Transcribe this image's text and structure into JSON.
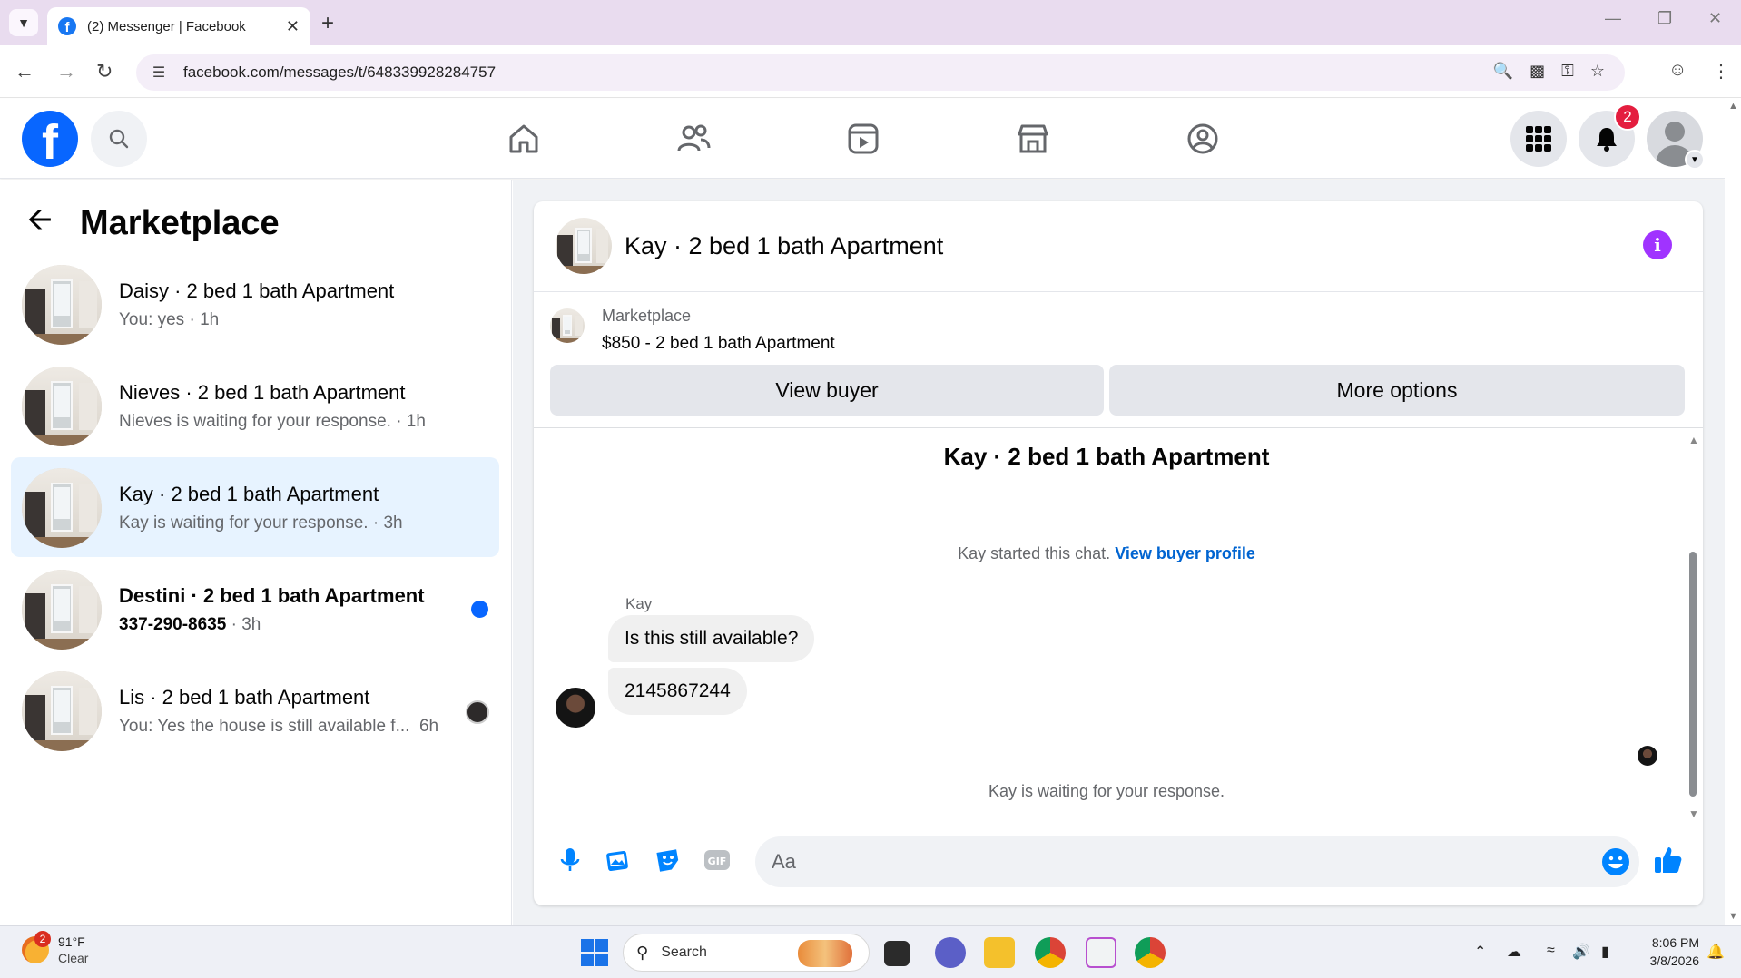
{
  "browser": {
    "tab_title": "(2) Messenger | Facebook",
    "url": "facebook.com/messages/t/648339928284757"
  },
  "header": {
    "notifications_count": "2"
  },
  "sidebar": {
    "title": "Marketplace",
    "conversations": [
      {
        "name": "Daisy · 2 bed 1 bath Apartment",
        "preview": "You: yes · 1h",
        "active": false,
        "unread": false
      },
      {
        "name": "Nieves · 2 bed 1 bath Apartment",
        "preview": "Nieves is waiting for your response. · 1h",
        "active": false,
        "unread": false
      },
      {
        "name": "Kay · 2 bed 1 bath Apartment",
        "preview": "Kay is waiting for your response. · 3h",
        "active": true,
        "unread": false
      },
      {
        "name": "Destini · 2 bed 1 bath Apartment",
        "preview_bold": "337-290-8635",
        "preview_time": " · 3h",
        "active": false,
        "unread": true
      },
      {
        "name": "Lis · 2 bed 1 bath Apartment",
        "preview": "You: Yes the house is still available f...",
        "preview_time": "6h",
        "active": false,
        "unread": false
      }
    ]
  },
  "chat": {
    "title": "Kay · 2 bed 1 bath Apartment",
    "marketplace_label": "Marketplace",
    "listing": "$850 - 2 bed 1 bath Apartment",
    "view_buyer_label": "View buyer",
    "more_options_label": "More options",
    "thread_title": "Kay · 2 bed 1 bath Apartment",
    "started_text": "Kay started this chat.",
    "view_profile_link": "View buyer profile",
    "sender_name": "Kay",
    "messages": [
      "Is this still available?",
      "2145867244"
    ],
    "waiting_text": "Kay is waiting for your response.",
    "composer_placeholder": "Aa"
  },
  "taskbar": {
    "weather_temp": "91°F",
    "weather_cond": "Clear",
    "weather_badge": "2",
    "search_label": "Search",
    "time": "8:06 PM",
    "date": "3/8/2026"
  },
  "colors": {
    "fb_blue": "#0866ff",
    "messenger_accent": "#0084ff",
    "info_purple": "#a033ff",
    "active_row": "#e7f3ff"
  }
}
